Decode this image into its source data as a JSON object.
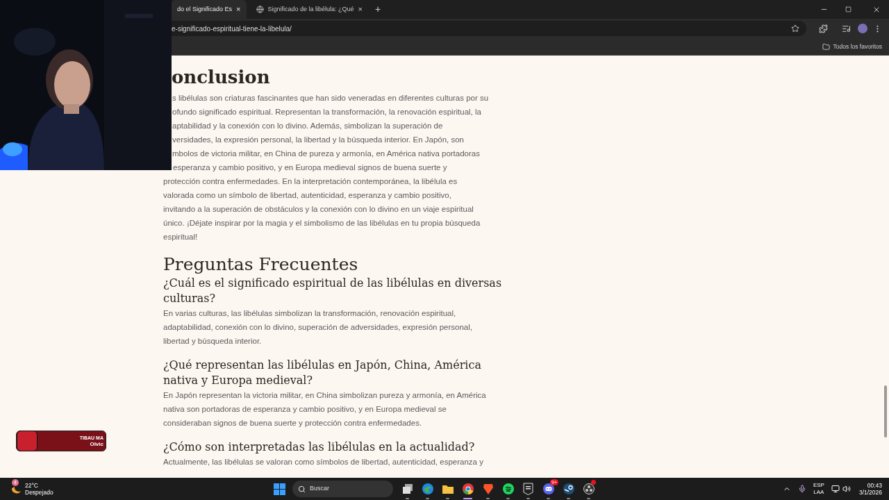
{
  "browser": {
    "tabs": [
      {
        "title": "do el Significado Es",
        "close": "×",
        "selected": true
      },
      {
        "title": "Significado de la libélula: ¿Qué",
        "close": "×",
        "selected": false
      }
    ],
    "new_tab": "+",
    "url": "e-significado-espiritual-tiene-la-libelula/",
    "bookmarks_folder": "Todos los favoritos"
  },
  "article": {
    "conclusion_heading": "onclusion",
    "conclusion_cut_lines": [
      "s libélulas son criaturas fascinantes que han sido veneradas en diferentes culturas por su",
      "ofundo significado espiritual. Representan la transformación, la renovación espiritual, la",
      "aptabilidad y la conexión con lo divino. Además, simbolizan la superación de",
      "versidades, la expresión personal, la libertad y la búsqueda interior. En Japón, son",
      "mbolos de victoria militar, en China de pureza y armonía, en América nativa portadoras",
      "esperanza y cambio positivo, y en Europa medieval signos de buena suerte y"
    ],
    "conclusion_rest": "protección contra enfermedades. En la interpretación contemporánea, la libélula es valorada como un símbolo de libertad, autenticidad, esperanza y cambio positivo, invitando a la superación de obstáculos y la conexión con lo divino en un viaje espiritual único. ¡Déjate inspirar por la magia y el simbolismo de las libélulas en tu propia búsqueda espiritual!",
    "faq_heading": "Preguntas Frecuentes",
    "faqs": [
      {
        "question": "¿Cuál es el significado espiritual de las libélulas en diversas culturas?",
        "answer": "En varias culturas, las libélulas simbolizan la transformación, renovación espiritual, adaptabilidad, conexión con lo divino, superación de adversidades, expresión personal, libertad y búsqueda interior."
      },
      {
        "question": "¿Qué representan las libélulas en Japón, China, América nativa y Europa medieval?",
        "answer": "En Japón representan la victoria militar, en China simbolizan pureza y armonía, en América nativa son portadoras de esperanza y cambio positivo, y en Europa medieval se consideraban signos de buena suerte y protección contra enfermedades."
      },
      {
        "question": "¿Cómo son interpretadas las libélulas en la actualidad?",
        "answer": "Actualmente, las libélulas se valoran como símbolos de libertad, autenticidad, esperanza y"
      }
    ]
  },
  "media_widget": {
    "label": "TIBAU MA",
    "title": "Olvic"
  },
  "taskbar": {
    "weather": {
      "badge": "4",
      "temperature": "22°C",
      "condition": "Despejado"
    },
    "search_placeholder": "Buscar",
    "apps": [
      {
        "kind": "taskview",
        "active": false
      },
      {
        "kind": "edge",
        "active": false
      },
      {
        "kind": "explorer",
        "active": false
      },
      {
        "kind": "chrome",
        "active": true
      },
      {
        "kind": "brave",
        "active": false
      },
      {
        "kind": "spotify",
        "active": false
      },
      {
        "kind": "epic",
        "active": false
      },
      {
        "kind": "discord",
        "active": false,
        "badge": "9+"
      },
      {
        "kind": "steam",
        "active": false
      },
      {
        "kind": "obs",
        "active": false
      }
    ],
    "language": "ESP",
    "layout": "LAA",
    "time": "00:43",
    "date": "3/1/2026"
  }
}
